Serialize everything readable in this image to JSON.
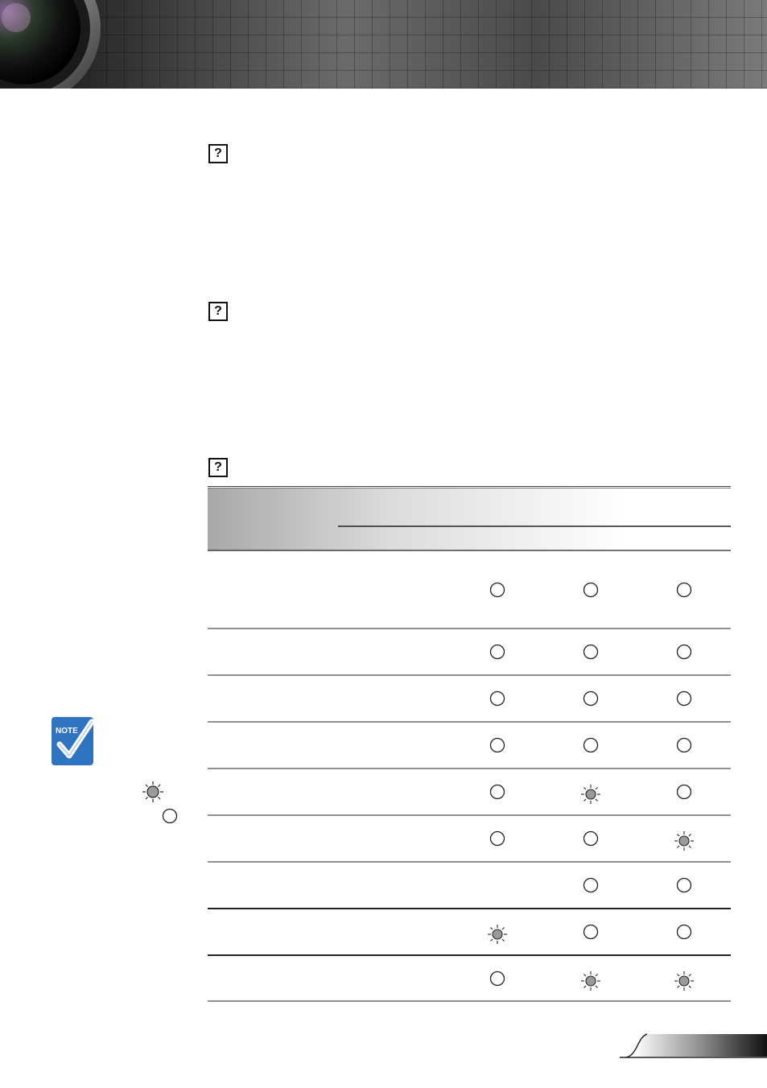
{
  "header": {
    "banner_icon": "projector-lens-icon"
  },
  "sections": [
    {
      "icon": "question-box-icon"
    },
    {
      "icon": "question-box-icon"
    },
    {
      "icon": "question-box-icon"
    }
  ],
  "note": {
    "badge_label": "NOTE",
    "legend": [
      {
        "icon": "led-flashing-icon"
      },
      {
        "icon": "led-off-icon"
      }
    ]
  },
  "status_table": {
    "columns": 3,
    "rows": [
      {
        "states": [
          "off",
          "off",
          "off"
        ]
      },
      {
        "states": [
          "off",
          "off",
          "off"
        ]
      },
      {
        "states": [
          "off",
          "off",
          "off"
        ]
      },
      {
        "states": [
          "off",
          "off",
          "off"
        ]
      },
      {
        "states": [
          "off",
          "flash",
          "off"
        ]
      },
      {
        "states": [
          "off",
          "off",
          "flash"
        ]
      },
      {
        "states": [
          "none",
          "off",
          "off"
        ]
      },
      {
        "states": [
          "flash",
          "off",
          "off"
        ]
      },
      {
        "states": [
          "off",
          "flash",
          "flash"
        ]
      }
    ]
  },
  "colors": {
    "banner_dark": "#1a1a1a",
    "note_blue": "#2e74c0",
    "rule": "#222222"
  }
}
